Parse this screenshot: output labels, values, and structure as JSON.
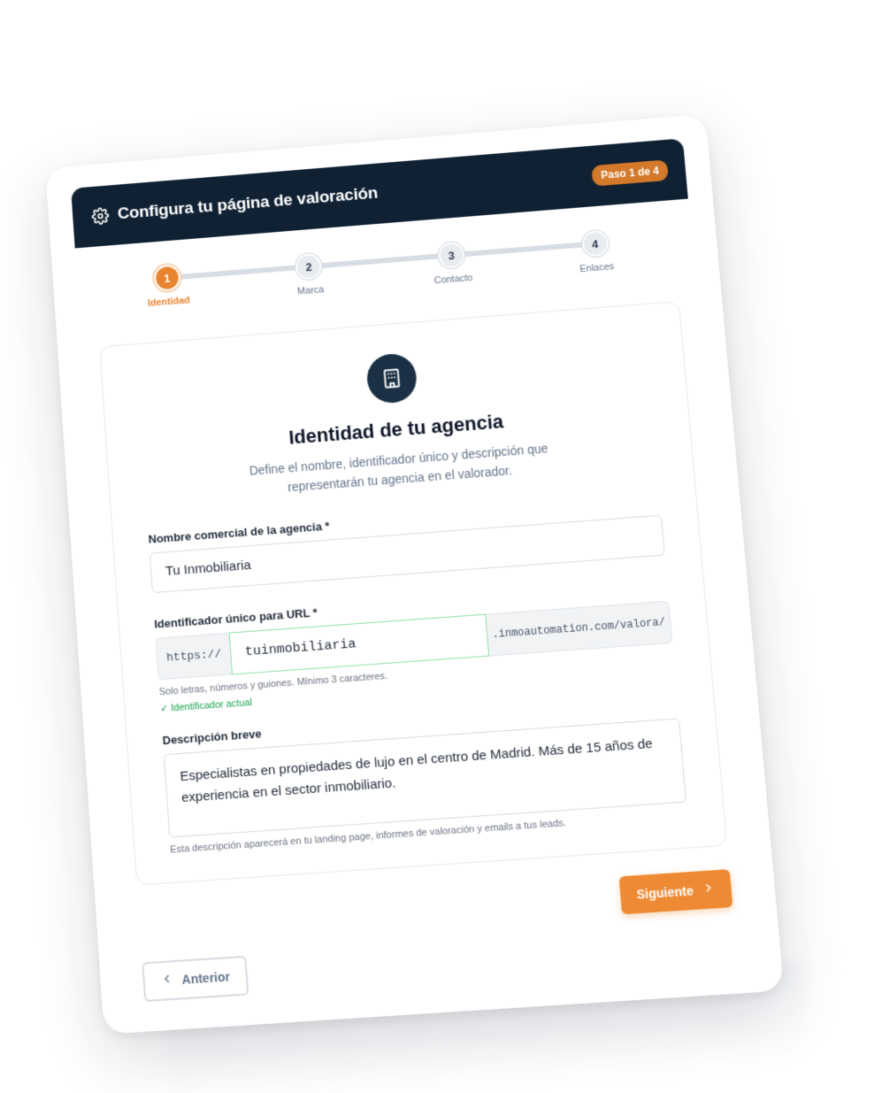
{
  "header": {
    "title": "Configura tu página de valoración",
    "step_badge": "Paso 1 de 4",
    "icon": "gear-icon"
  },
  "stepper": {
    "steps": [
      {
        "number": "1",
        "label": "Identidad",
        "active": true
      },
      {
        "number": "2",
        "label": "Marca",
        "active": false
      },
      {
        "number": "3",
        "label": "Contacto",
        "active": false
      },
      {
        "number": "4",
        "label": "Enlaces",
        "active": false
      }
    ]
  },
  "panel": {
    "icon": "building-icon",
    "title": "Identidad de tu agencia",
    "subtitle": "Define el nombre, identificador único y descripción que representarán tu agencia en el valorador."
  },
  "form": {
    "name": {
      "label": "Nombre comercial de la agencia *",
      "value": "Tu Inmobiliaria"
    },
    "slug": {
      "label": "Identificador único para URL *",
      "prefix": "https://",
      "value": "tuinmobiliaria",
      "suffix": ".inmoautomation.com/valora/",
      "hint": "Solo letras, números y guiones. Mínimo 3 caracteres.",
      "status": "✓ Identificador actual"
    },
    "description": {
      "label": "Descripción breve",
      "value": "Especialistas en propiedades de lujo en el centro de Madrid. Más de 15 años de experiencia en el sector inmobiliario.",
      "hint": "Esta descripción aparecerá en tu landing page, informes de valoración y emails a tus leads."
    }
  },
  "actions": {
    "next_label": "Siguiente",
    "prev_label": "Anterior"
  },
  "colors": {
    "header_bg": "#0f2133",
    "accent": "#ee8a33",
    "badge": "#d4782a",
    "success": "#16a34a"
  }
}
